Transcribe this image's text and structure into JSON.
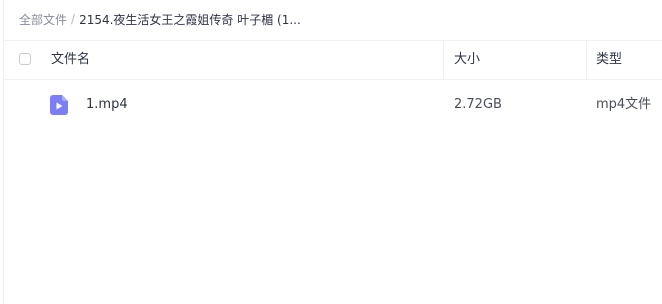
{
  "breadcrumb": {
    "root": "全部文件",
    "separator": "/",
    "current": "2154.夜生活女王之霞姐传奇 叶子楣 (1..."
  },
  "table": {
    "columns": {
      "name": "文件名",
      "size": "大小",
      "type": "类型"
    },
    "rows": [
      {
        "icon": "video-file-icon",
        "name": "1.mp4",
        "size": "2.72GB",
        "type": "mp4文件"
      }
    ]
  },
  "colors": {
    "icon_accent": "#7b7ef5",
    "text_primary": "#2f3345",
    "text_muted": "#878c9c"
  }
}
